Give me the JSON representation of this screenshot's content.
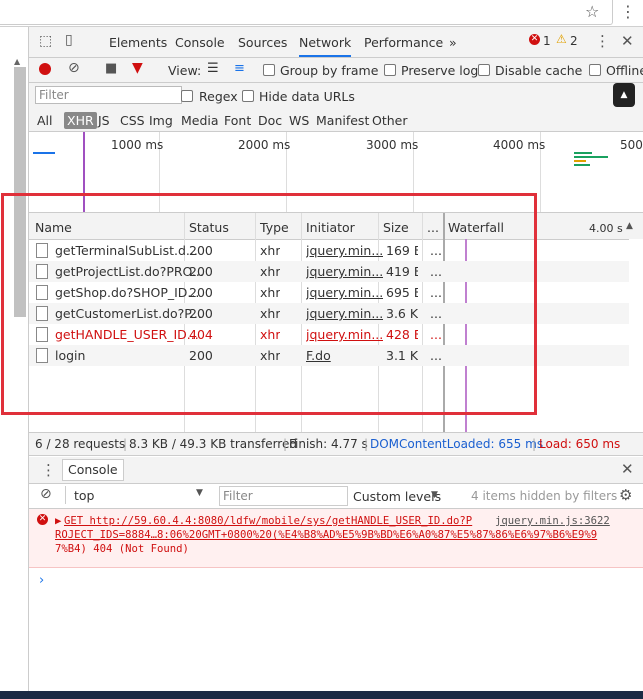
{
  "devtools": {
    "tabs": [
      "Elements",
      "Console",
      "Sources",
      "Network",
      "Performance"
    ],
    "tabs_more": "»",
    "error_count": "1",
    "warning_count": "2"
  },
  "toolbar": {
    "view_label": "View:",
    "group_by_frame": "Group by frame",
    "preserve_log": "Preserve log",
    "disable_cache": "Disable cache",
    "offline": "Offline"
  },
  "filterbar": {
    "placeholder": "Filter",
    "regex": "Regex",
    "hide_data_urls": "Hide data URLs",
    "types": [
      "All",
      "XHR",
      "JS",
      "CSS",
      "Img",
      "Media",
      "Font",
      "Doc",
      "WS",
      "Manifest",
      "Other"
    ]
  },
  "overview": {
    "ticks": [
      "1000 ms",
      "2000 ms",
      "3000 ms",
      "4000 ms",
      "500"
    ]
  },
  "table": {
    "headers": [
      "Name",
      "Status",
      "Type",
      "Initiator",
      "Size",
      "...",
      "Waterfall"
    ],
    "waterfall_time": "4.00 s",
    "rows": [
      {
        "name": "getTerminalSubList.d...",
        "status": "200",
        "type": "xhr",
        "initiator": "jquery.min...",
        "size": "169 B",
        "time": "...",
        "error": false
      },
      {
        "name": "getProjectList.do?PRO...",
        "status": "200",
        "type": "xhr",
        "initiator": "jquery.min...",
        "size": "419 B",
        "time": "...",
        "error": false
      },
      {
        "name": "getShop.do?SHOP_ID...",
        "status": "200",
        "type": "xhr",
        "initiator": "jquery.min...",
        "size": "695 B",
        "time": "...",
        "error": false
      },
      {
        "name": "getCustomerList.do?P...",
        "status": "200",
        "type": "xhr",
        "initiator": "jquery.min...",
        "size": "3.6 KB",
        "time": "...",
        "error": false
      },
      {
        "name": "getHANDLE_USER_ID...",
        "status": "404",
        "type": "xhr",
        "initiator": "jquery.min...",
        "size": "428 B",
        "time": "...",
        "error": true
      },
      {
        "name": "login",
        "status": "200",
        "type": "xhr",
        "initiator": "F.do",
        "size": "3.1 KB",
        "time": "...",
        "error": false
      }
    ]
  },
  "summary": {
    "requests": "6 / 28 requests",
    "transferred": "8.3 KB / 49.3 KB transferred",
    "finish": "Finish: 4.77 s",
    "domcontentloaded": "DOMContentLoaded: 655 ms",
    "load": "Load: 650 ms"
  },
  "console": {
    "tab_label": "Console",
    "context": "top",
    "filter_placeholder": "Filter",
    "levels": "Custom levels",
    "hidden": "4 items hidden by filters",
    "message_lines": [
      "GET http://59.60.4.4:8080/ldfw/mobile/sys/getHANDLE_USER_ID.do?P",
      "ROJECT_IDS=8884…8:06%20GMT+0800%20(%E4%B8%AD%E5%9B%BD%E6%A0%87%E5%87%86%E6%97%B6%E9%9",
      "7%B4) 404 (Not Found)"
    ],
    "message_source": "jquery.min.js:3622"
  },
  "colors": {
    "error_red": "#d01010",
    "accent_blue": "#1a73e8",
    "highlight_box": "#e0303a"
  }
}
